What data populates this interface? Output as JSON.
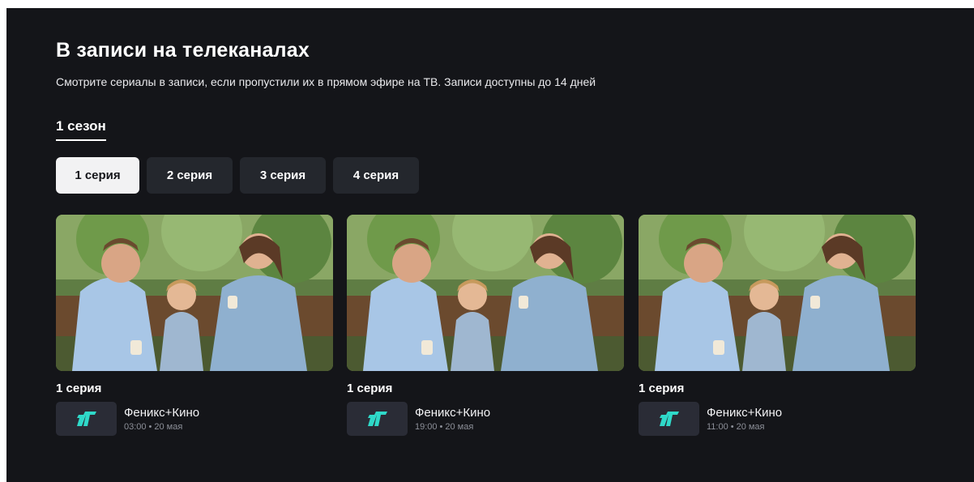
{
  "section": {
    "title": "В записи на телеканалах",
    "subtitle": "Смотрите сериалы в записи, если пропустили их в прямом эфире на ТВ. Записи доступны до 14 дней"
  },
  "season_tab": {
    "label": "1 сезон"
  },
  "episodes": [
    {
      "label": "1 серия",
      "active": true
    },
    {
      "label": "2 серия",
      "active": false
    },
    {
      "label": "3 серия",
      "active": false
    },
    {
      "label": "4 серия",
      "active": false
    }
  ],
  "recordings": [
    {
      "title": "1 серия",
      "channel": "Феникс+Кино",
      "time": "03:00",
      "date": "20 мая"
    },
    {
      "title": "1 серия",
      "channel": "Феникс+Кино",
      "time": "19:00",
      "date": "20 мая"
    },
    {
      "title": "1 серия",
      "channel": "Феникс+Кино",
      "time": "11:00",
      "date": "20 мая"
    }
  ],
  "separator": "•",
  "colors": {
    "background": "#141519",
    "button": "#24272d",
    "button_active": "#f2f2f3",
    "logo_accent": "#2fd9c9"
  },
  "icons": {
    "channel_logo": "feniks-kino-logo"
  }
}
